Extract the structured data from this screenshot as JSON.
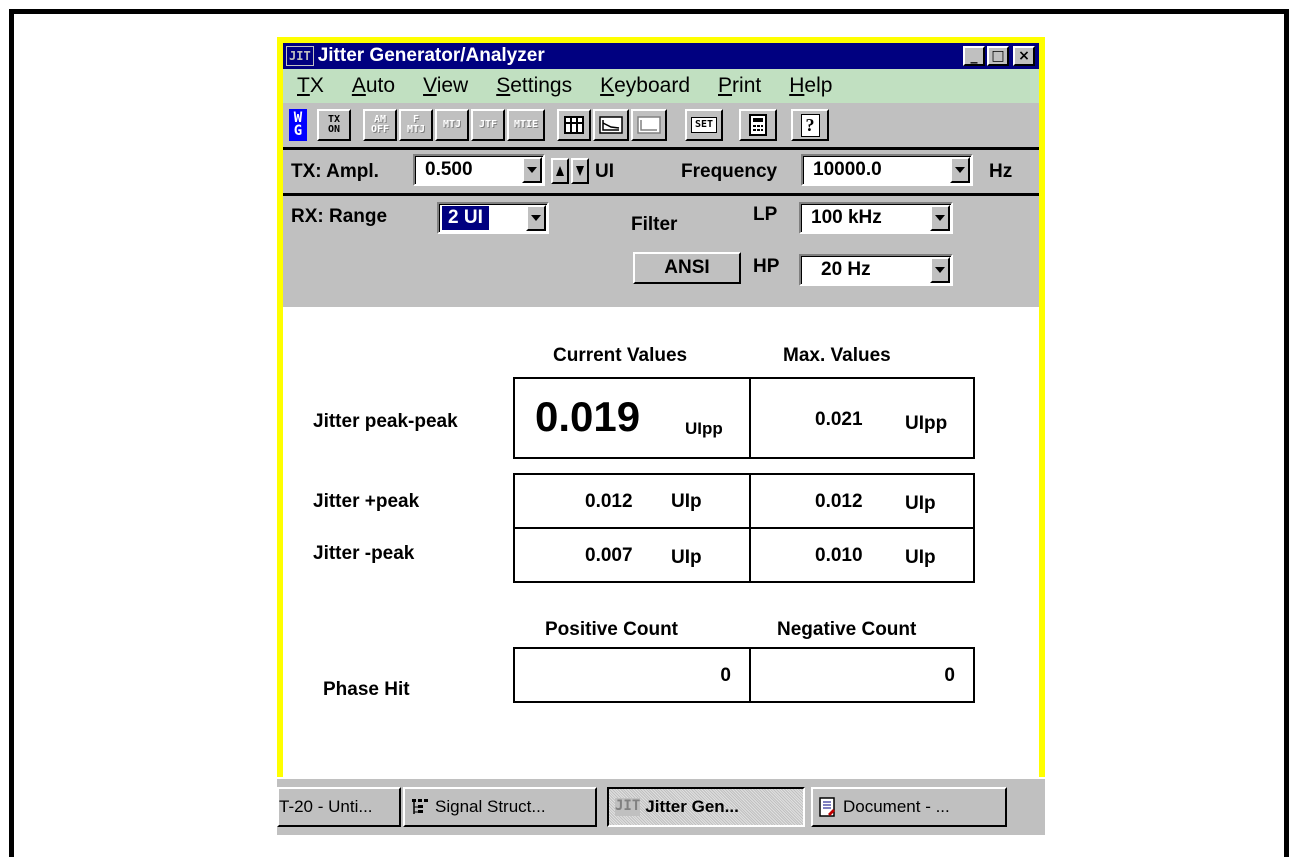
{
  "window": {
    "app_icon": "JIT",
    "title": "Jitter Generator/Analyzer",
    "controls": {
      "minimize": "_",
      "maximize": "□",
      "close": "×"
    }
  },
  "menu": {
    "items": [
      {
        "label": "TX",
        "accel": "T"
      },
      {
        "label": "Auto",
        "accel": "A"
      },
      {
        "label": "View",
        "accel": "V"
      },
      {
        "label": "Settings",
        "accel": "S"
      },
      {
        "label": "Keyboard",
        "accel": "K"
      },
      {
        "label": "Print",
        "accel": "P"
      },
      {
        "label": "Help",
        "accel": "H"
      }
    ]
  },
  "toolbar": {
    "logo_top": "W",
    "logo_bottom": "G",
    "tx_on_top": "TX",
    "tx_on_bottom": "ON",
    "am_off_top": "AM",
    "am_off_bottom": "OFF",
    "f_mtj_top": "F",
    "f_mtj_bottom": "MTJ",
    "mtj": "MTJ",
    "jtf": "JTF",
    "mtie": "MTIE",
    "set": "SET",
    "help": "?"
  },
  "tx": {
    "label": "TX: Ampl.",
    "amplitude": "0.500",
    "amplitude_unit": "UI",
    "frequency_label": "Frequency",
    "frequency": "10000.0",
    "frequency_unit": "Hz"
  },
  "rx": {
    "label": "RX:  Range",
    "range": "2 UI",
    "filter_label": "Filter",
    "lp_label": "LP",
    "lp_value": "100 kHz",
    "hp_label": "HP",
    "hp_value": "20 Hz",
    "ansi_button": "ANSI"
  },
  "results": {
    "col_current": "Current Values",
    "col_max": "Max. Values",
    "pp_label": "Jitter  peak-peak",
    "pp_current": "0.019",
    "pp_current_unit": "UIpp",
    "pp_max": "0.021",
    "pp_max_unit": "UIpp",
    "pos_label": "Jitter  +peak",
    "pos_current": "0.012",
    "pos_current_unit": "UIp",
    "pos_max": "0.012",
    "pos_max_unit": "UIp",
    "neg_label": "Jitter  -peak",
    "neg_current": "0.007",
    "neg_current_unit": "UIp",
    "neg_max": "0.010",
    "neg_max_unit": "UIp",
    "col_positive": "Positive Count",
    "col_negative": "Negative Count",
    "hit_label": "Phase Hit",
    "hit_positive": "0",
    "hit_negative": "0"
  },
  "taskbar": {
    "items": [
      {
        "label": "T-20 - Unti...",
        "icon": ""
      },
      {
        "label": "Signal Struct...",
        "icon": "tree-icon"
      },
      {
        "label": "Jitter Gen...",
        "icon": "JIT"
      },
      {
        "label": "Document - ...",
        "icon": "document-icon"
      }
    ]
  }
}
